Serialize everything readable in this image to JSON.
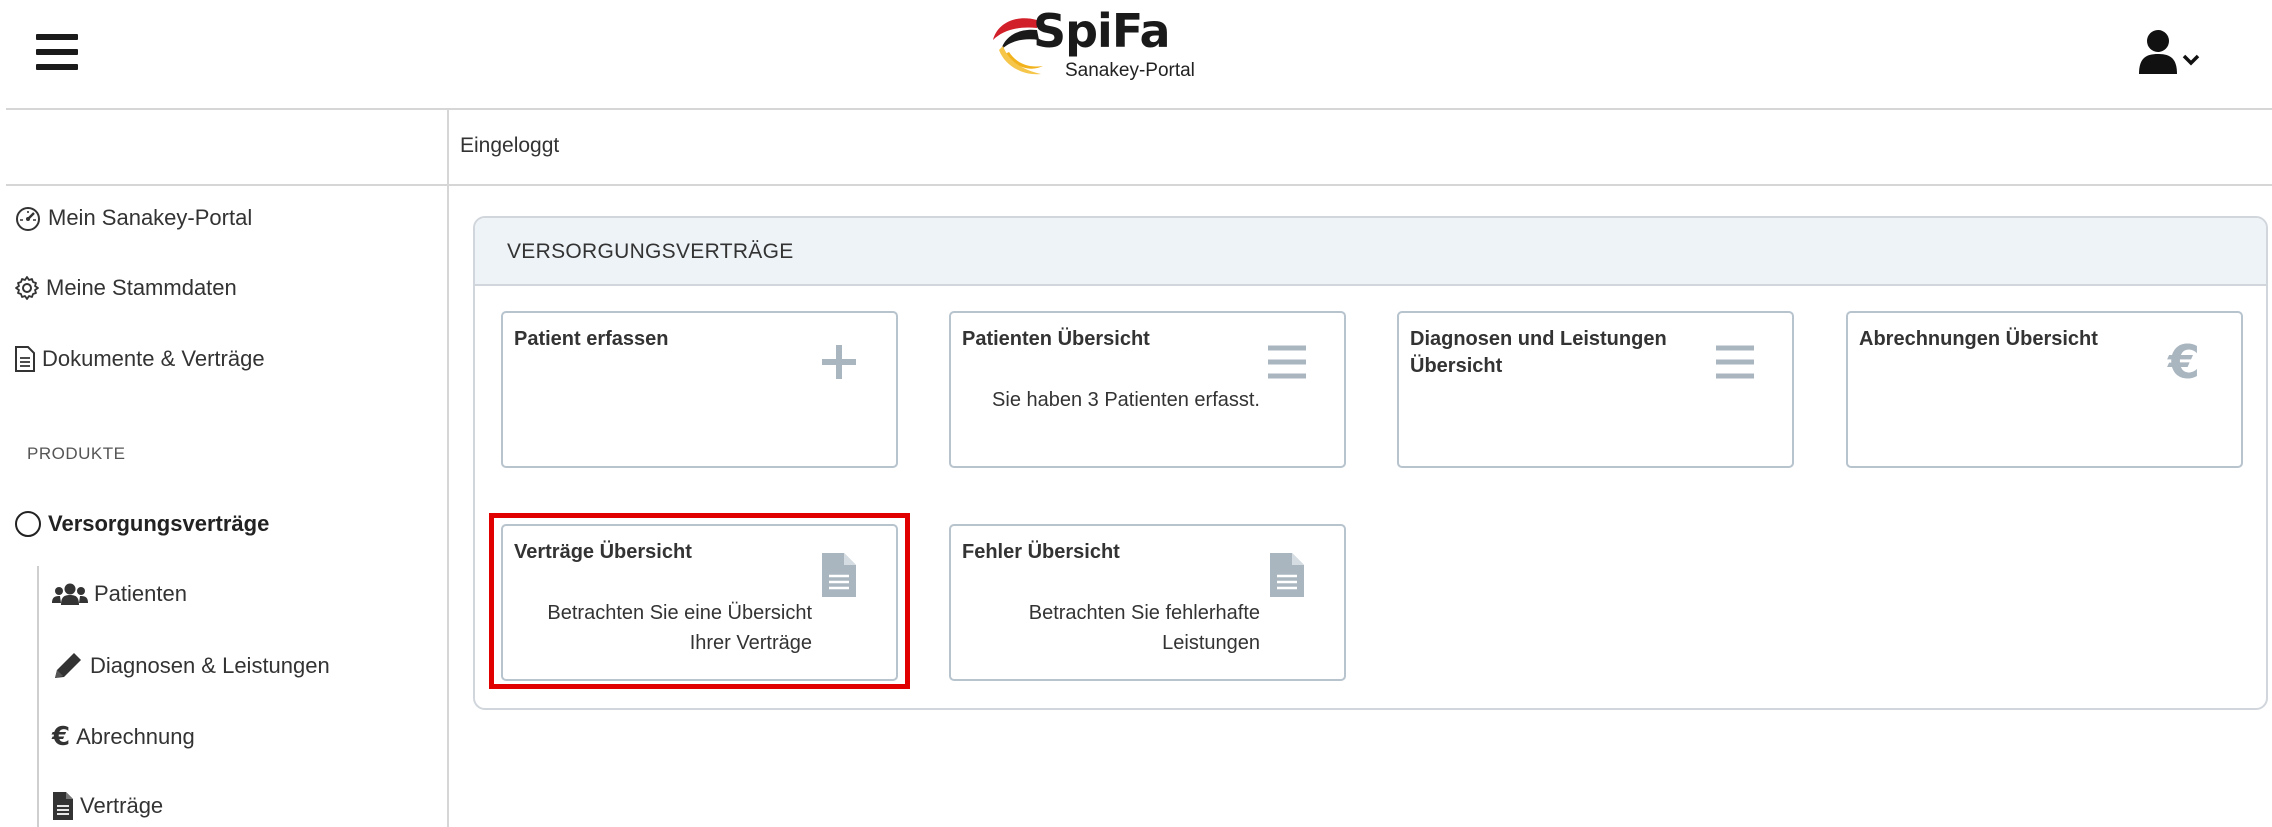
{
  "header": {
    "logo_text": "SpiFa",
    "logo_subtitle": "Sanakey-Portal",
    "menu_icon": "hamburger-icon",
    "user_icon": "user-icon"
  },
  "status": {
    "text": "Eingeloggt"
  },
  "sidebar": {
    "items": [
      {
        "label": "Mein Sanakey-Portal",
        "icon": "dashboard-icon"
      },
      {
        "label": "Meine Stammdaten",
        "icon": "gear-icon"
      },
      {
        "label": "Dokumente & Verträge",
        "icon": "document-icon"
      }
    ],
    "section_label": "PRODUKTE",
    "active_item": {
      "label": "Versorgungsverträge",
      "icon": "circle-icon"
    },
    "sub_items": [
      {
        "label": "Patienten",
        "icon": "users-icon"
      },
      {
        "label": "Diagnosen & Leistungen",
        "icon": "pencil-icon"
      },
      {
        "label": "Abrechnung",
        "icon": "euro-icon"
      },
      {
        "label": "Verträge",
        "icon": "file-icon"
      }
    ]
  },
  "panel": {
    "title": "VERSORGUNGSVERTRÄGE",
    "cards": [
      {
        "title": "Patient erfassen",
        "text": "",
        "icon": "plus-icon"
      },
      {
        "title": "Patienten Übersicht",
        "text": "Sie haben 3 Patienten erfasst.",
        "icon": "list-icon"
      },
      {
        "title": "Diagnosen und Leistungen Übersicht",
        "text": "",
        "icon": "list-icon"
      },
      {
        "title": "Abrechnungen Übersicht",
        "text": "",
        "icon": "euro-icon"
      },
      {
        "title": "Verträge Übersicht",
        "text": "Betrachten Sie eine Übersicht Ihrer Verträge",
        "icon": "file-icon"
      },
      {
        "title": "Fehler Übersicht",
        "text": "Betrachten Sie fehlerhafte Leistungen",
        "icon": "file-icon"
      }
    ]
  },
  "colors": {
    "highlight": "#e10000",
    "icon_gray": "#a9b5bf",
    "panel_header_bg": "#eef3f7",
    "card_border": "#b7c3cd"
  }
}
